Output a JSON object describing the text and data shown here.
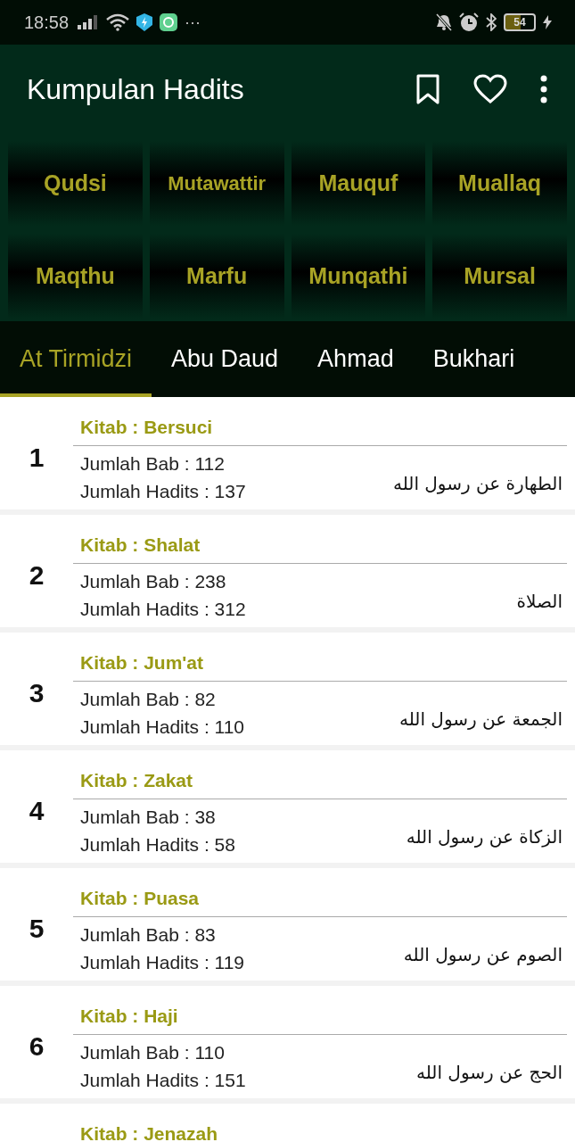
{
  "status_bar": {
    "time": "18:58",
    "more": "···",
    "battery": "54"
  },
  "app_bar": {
    "title": "Kumpulan Hadits"
  },
  "categories": [
    "Qudsi",
    "Mutawattir",
    "Mauquf",
    "Muallaq",
    "Maqthu",
    "Marfu",
    "Munqathi",
    "Mursal"
  ],
  "tabs": [
    {
      "label": "At Tirmidzi",
      "selected": true
    },
    {
      "label": "Abu Daud",
      "selected": false
    },
    {
      "label": "Ahmad",
      "selected": false
    },
    {
      "label": "Bukhari",
      "selected": false
    }
  ],
  "kitab_list": [
    {
      "number": "1",
      "title": "Kitab : Bersuci",
      "bab": "Jumlah Bab : 112",
      "hadits": "Jumlah Hadits : 137",
      "arabic": "الطهارة عن رسول الله"
    },
    {
      "number": "2",
      "title": "Kitab : Shalat",
      "bab": "Jumlah Bab : 238",
      "hadits": "Jumlah Hadits : 312",
      "arabic": "الصلاة"
    },
    {
      "number": "3",
      "title": "Kitab : Jum'at",
      "bab": "Jumlah Bab : 82",
      "hadits": "Jumlah Hadits : 110",
      "arabic": "الجمعة عن رسول الله"
    },
    {
      "number": "4",
      "title": "Kitab : Zakat",
      "bab": "Jumlah Bab : 38",
      "hadits": "Jumlah Hadits : 58",
      "arabic": "الزكاة عن رسول الله"
    },
    {
      "number": "5",
      "title": "Kitab : Puasa",
      "bab": "Jumlah Bab : 83",
      "hadits": "Jumlah Hadits : 119",
      "arabic": "الصوم عن رسول الله"
    },
    {
      "number": "6",
      "title": "Kitab : Haji",
      "bab": "Jumlah Bab : 110",
      "hadits": "Jumlah Hadits : 151",
      "arabic": "الحج عن رسول الله"
    },
    {
      "title": "Kitab : Jenazah"
    }
  ]
}
